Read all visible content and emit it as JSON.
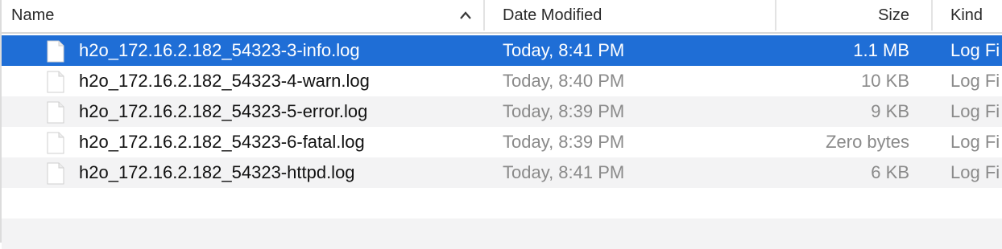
{
  "header": {
    "name_label": "Name",
    "date_label": "Date Modified",
    "size_label": "Size",
    "kind_label": "Kind",
    "sort_icon": "chevron-up-icon"
  },
  "files": [
    {
      "name": "h2o_172.16.2.182_54323-3-info.log",
      "date": "Today, 8:41 PM",
      "size": "1.1 MB",
      "kind": "Log Fi",
      "selected": true
    },
    {
      "name": "h2o_172.16.2.182_54323-4-warn.log",
      "date": "Today, 8:40 PM",
      "size": "10 KB",
      "kind": "Log Fi",
      "selected": false
    },
    {
      "name": "h2o_172.16.2.182_54323-5-error.log",
      "date": "Today, 8:39 PM",
      "size": "9 KB",
      "kind": "Log Fi",
      "selected": false
    },
    {
      "name": "h2o_172.16.2.182_54323-6-fatal.log",
      "date": "Today, 8:39 PM",
      "size": "Zero bytes",
      "kind": "Log Fi",
      "selected": false
    },
    {
      "name": "h2o_172.16.2.182_54323-httpd.log",
      "date": "Today, 8:41 PM",
      "size": "6 KB",
      "kind": "Log Fi",
      "selected": false
    }
  ],
  "colors": {
    "selection": "#1f6ed6",
    "alt_row": "#f3f3f4",
    "secondary_text": "#8a8a8a"
  }
}
